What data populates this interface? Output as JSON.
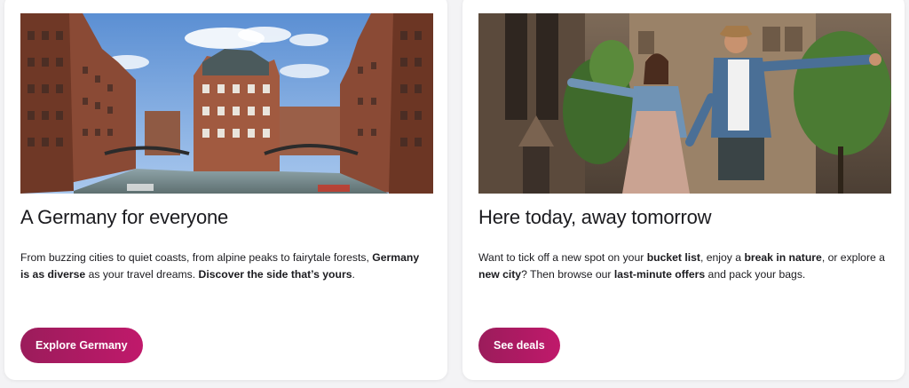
{
  "cards": [
    {
      "image_alt": "Speicherstadt canals and red brick warehouses",
      "title": "A Germany for everyone",
      "body": [
        {
          "text": "From buzzing cities to quiet coasts, from alpine peaks to fairytale forests, ",
          "bold": false
        },
        {
          "text": "Germany is as diverse",
          "bold": true
        },
        {
          "text": " as your travel dreams. ",
          "bold": false
        },
        {
          "text": "Discover the side that’s yours",
          "bold": true
        },
        {
          "text": ".",
          "bold": false
        }
      ],
      "button_label": "Explore Germany"
    },
    {
      "image_alt": "Happy couple running through a city street",
      "title": "Here today, away tomorrow",
      "body": [
        {
          "text": "Want to tick off a new spot on your ",
          "bold": false
        },
        {
          "text": "bucket list",
          "bold": true
        },
        {
          "text": ", enjoy a ",
          "bold": false
        },
        {
          "text": "break in nature",
          "bold": true
        },
        {
          "text": ", or explore a ",
          "bold": false
        },
        {
          "text": "new city",
          "bold": true
        },
        {
          "text": "? Then browse our ",
          "bold": false
        },
        {
          "text": "last-minute offers",
          "bold": true
        },
        {
          "text": " and pack your bags.",
          "bold": false
        }
      ],
      "button_label": "See deals"
    }
  ],
  "colors": {
    "button_start": "#9b1c5b",
    "button_end": "#c0196b",
    "page_bg": "#f3f3f5",
    "card_bg": "#ffffff"
  }
}
